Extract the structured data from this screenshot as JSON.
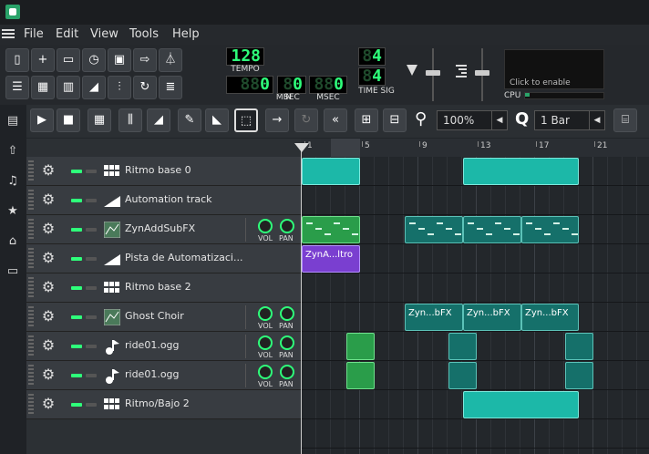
{
  "menu": {
    "items": [
      "File",
      "Edit",
      "View",
      "Tools",
      "Help"
    ],
    "underline": [
      "F",
      "E",
      "V",
      "T",
      "H"
    ]
  },
  "toolbar": {
    "tempo_value": "128",
    "tempo_label": "TEMPO",
    "min_value": "0",
    "min_label": "MIN",
    "sec_value": "0",
    "sec_label": "SEC",
    "msec_value": "0",
    "msec_label": "MSEC",
    "timesig_top": "4",
    "timesig_bottom": "4",
    "timesig_label": "TIME SIG",
    "cpu_hint": "Click to enable",
    "cpu_label": "CPU",
    "cpu_level": 0.06
  },
  "editor": {
    "zoom_value": "100%",
    "snap_value": "1 Bar"
  },
  "ruler": {
    "labels": [
      "1",
      "5",
      "9",
      "13",
      "17",
      "21"
    ]
  },
  "tracks": [
    {
      "name": "Ritmo base 0",
      "type": "beat",
      "knobs": false
    },
    {
      "name": "Automation track",
      "type": "automation",
      "knobs": false
    },
    {
      "name": "ZynAddSubFX",
      "type": "instrument",
      "knobs": true
    },
    {
      "name": "Pista de Automatizaci...",
      "type": "automation",
      "knobs": false
    },
    {
      "name": "Ritmo base 2",
      "type": "beat",
      "knobs": false
    },
    {
      "name": "Ghost Choir",
      "type": "instrument",
      "knobs": true
    },
    {
      "name": "ride01.ogg",
      "type": "sample",
      "knobs": true
    },
    {
      "name": "ride01.ogg",
      "type": "sample",
      "knobs": true
    },
    {
      "name": "Ritmo/Bajo 2",
      "type": "beat",
      "knobs": false
    }
  ],
  "knob_labels": {
    "vol": "VOL",
    "pan": "PAN"
  },
  "patterns": {
    "zyn_auto_label": "ZynA...ltro",
    "ghost_labels": [
      "Zyn...bFX",
      "Zyn...bFX",
      "Zyn...bFX"
    ]
  },
  "colors": {
    "accent": "#2eff7a",
    "beat": "#1cb8a8",
    "instrument": "#15706a",
    "automation": "#7a3fd0",
    "sample": "#2a9d4a"
  }
}
